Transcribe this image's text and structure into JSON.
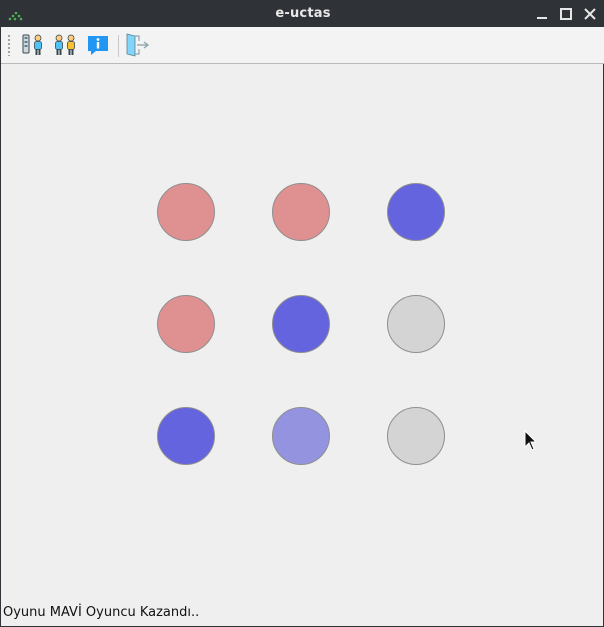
{
  "window": {
    "title": "e-uctas"
  },
  "toolbar": {
    "buttons": [
      {
        "icon": "player-vs-computer-icon"
      },
      {
        "icon": "two-players-icon"
      },
      {
        "icon": "info-icon"
      },
      {
        "icon": "exit-icon"
      }
    ]
  },
  "board": {
    "rows": [
      [
        {
          "state": "red"
        },
        {
          "state": "red"
        },
        {
          "state": "blue"
        }
      ],
      [
        {
          "state": "red"
        },
        {
          "state": "blue"
        },
        {
          "state": "empty"
        }
      ],
      [
        {
          "state": "blue"
        },
        {
          "state": "blue-highlight"
        },
        {
          "state": "empty"
        }
      ]
    ]
  },
  "colors": {
    "red": "#df9191",
    "blue": "#6464df",
    "blue-highlight": "#9393df",
    "empty": "#d4d4d4"
  },
  "status": {
    "text": "Oyunu MAVİ Oyuncu Kazandı.."
  }
}
